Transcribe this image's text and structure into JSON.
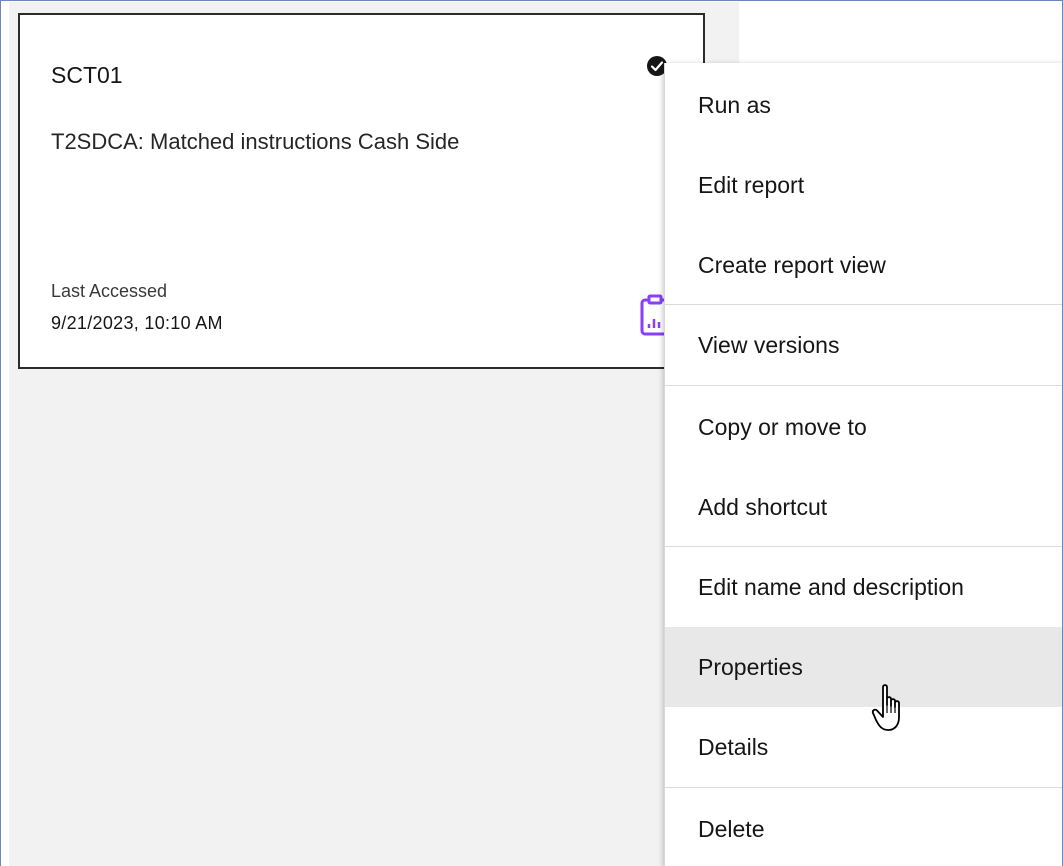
{
  "card": {
    "title": "SCT01",
    "description": "T2SDCA: Matched instructions Cash Side",
    "last_accessed_label": "Last Accessed",
    "last_accessed_value": "9/21/2023, 10:10 AM",
    "status_icon": "checkmark-filled-icon",
    "type_icon": "report-icon"
  },
  "menu": {
    "items": [
      {
        "label": "Run as"
      },
      {
        "label": "Edit report"
      },
      {
        "label": "Create report view"
      },
      {
        "label": "View versions"
      },
      {
        "label": "Copy or move to"
      },
      {
        "label": "Add shortcut"
      },
      {
        "label": "Edit name and description"
      },
      {
        "label": "Properties",
        "hovered": true
      },
      {
        "label": "Details"
      },
      {
        "label": "Delete"
      }
    ]
  },
  "colors": {
    "card_border": "#2b2b2b",
    "canvas_background": "#f2f2f2",
    "report_icon": "#8a3ffc",
    "menu_hover": "#e8e8e8",
    "frame_border": "#6b86b8"
  },
  "cursor_icon": "hand-pointer-icon"
}
